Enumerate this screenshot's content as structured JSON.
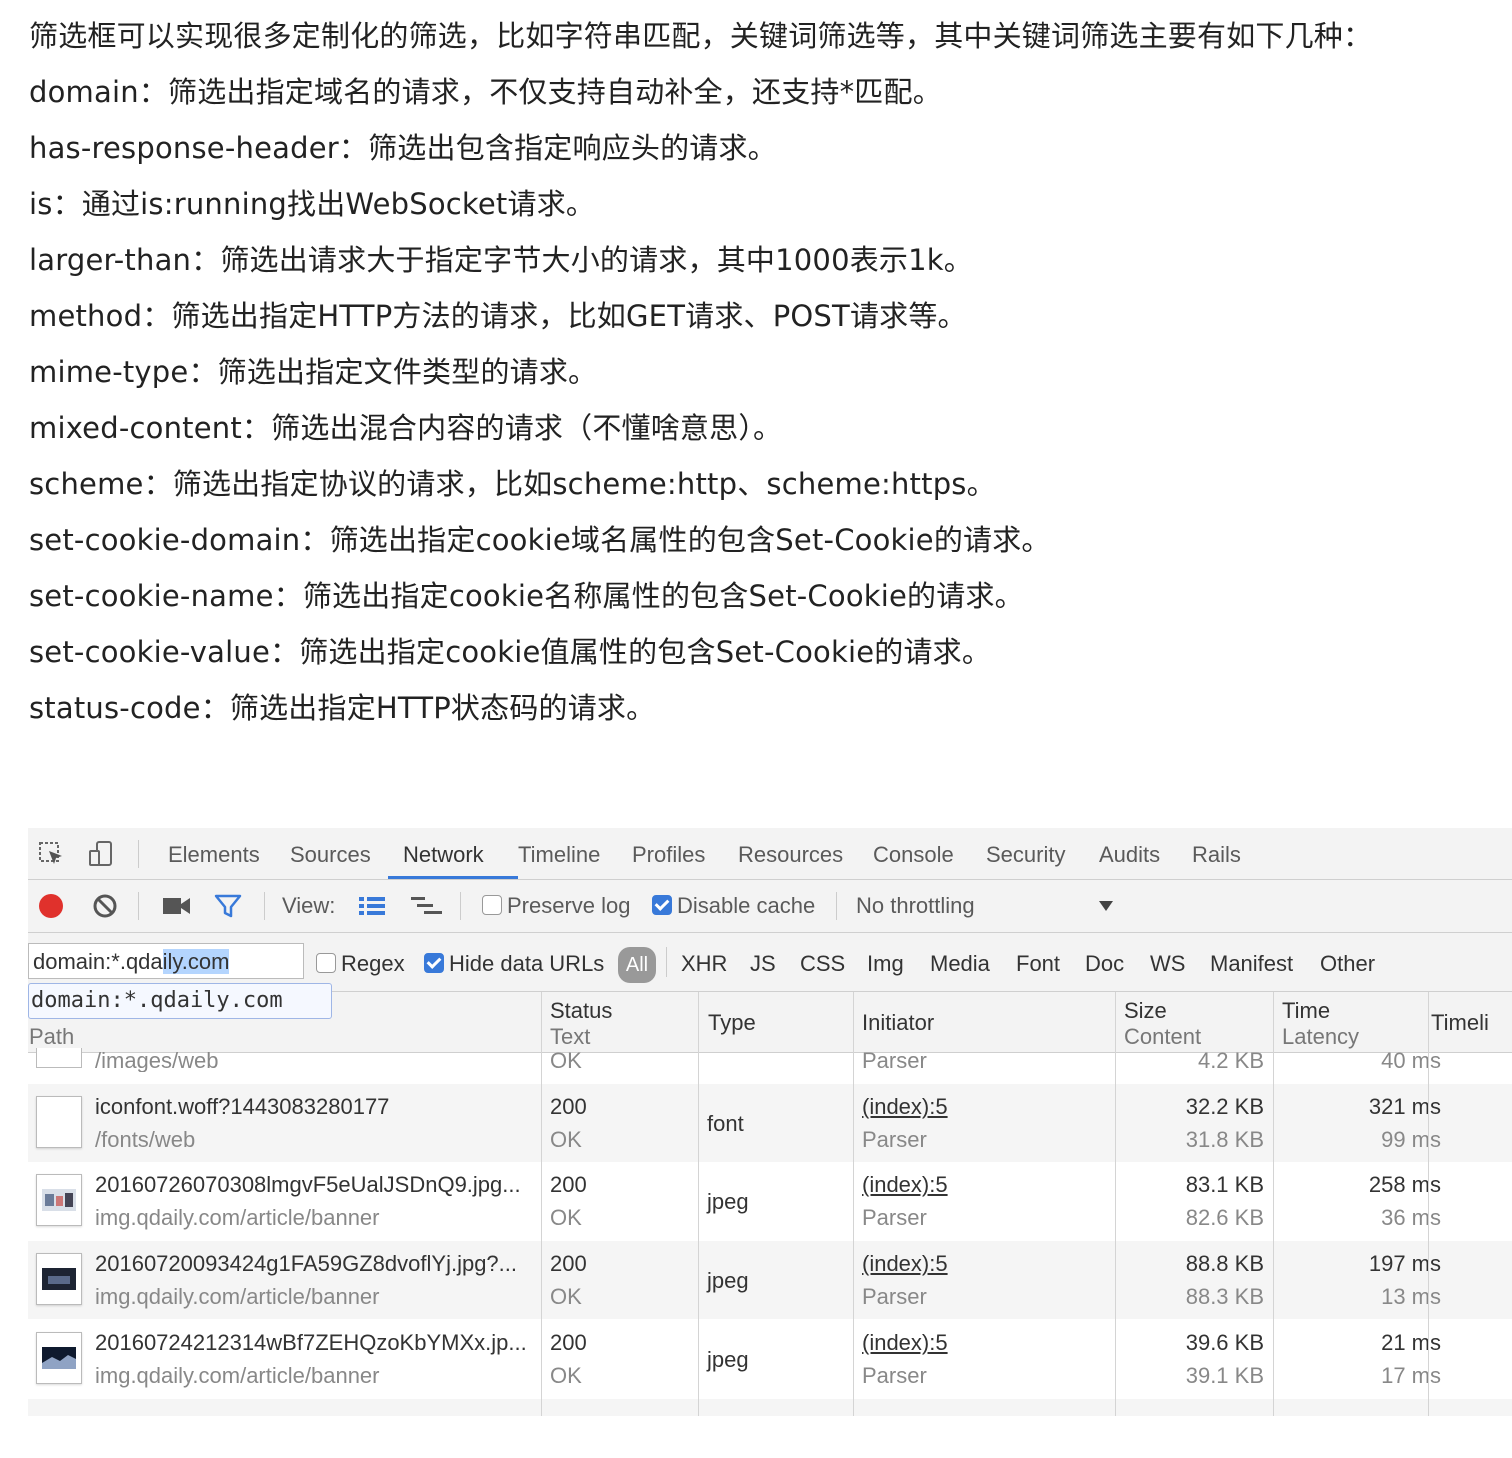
{
  "article": {
    "intro": "筛选框可以实现很多定制化的筛选，比如字符串匹配，关键词筛选等，其中关键词筛选主要有如下几种：",
    "lines": [
      "domain：筛选出指定域名的请求，不仅支持自动补全，还支持*匹配。",
      "has-response-header：筛选出包含指定响应头的请求。",
      "is：通过is:running找出WebSocket请求。",
      "larger-than：筛选出请求大于指定字节大小的请求，其中1000表示1k。",
      "method：筛选出指定HTTP方法的请求，比如GET请求、POST请求等。",
      "mime-type：筛选出指定文件类型的请求。",
      "mixed-content：筛选出混合内容的请求（不懂啥意思）。",
      "scheme：筛选出指定协议的请求，比如scheme:http、scheme:https。",
      "set-cookie-domain：筛选出指定cookie域名属性的包含Set-Cookie的请求。",
      "set-cookie-name：筛选出指定cookie名称属性的包含Set-Cookie的请求。",
      "set-cookie-value：筛选出指定cookie值属性的包含Set-Cookie的请求。",
      "status-code：筛选出指定HTTP状态码的请求。"
    ]
  },
  "devtools": {
    "tabs": [
      "Elements",
      "Sources",
      "Network",
      "Timeline",
      "Profiles",
      "Resources",
      "Console",
      "Security",
      "Audits",
      "Rails"
    ],
    "active_tab": "Network",
    "toolbar": {
      "view_label": "View:",
      "preserve_log": "Preserve log",
      "disable_cache": "Disable cache",
      "throttling": "No throttling"
    },
    "filter": {
      "value_pre": "domain:*.qda",
      "value_sel": "ily.com",
      "suggestion": "domain:*.qdaily.com",
      "regex": "Regex",
      "hide_data_urls": "Hide data URLs",
      "all": "All",
      "types": [
        "XHR",
        "JS",
        "CSS",
        "Img",
        "Media",
        "Font",
        "Doc",
        "WS",
        "Manifest",
        "Other"
      ]
    },
    "columns": {
      "path": "Path",
      "status": "Status",
      "status_sub": "Text",
      "type": "Type",
      "initiator": "Initiator",
      "size": "Size",
      "size_sub": "Content",
      "time": "Time",
      "time_sub": "Latency",
      "timeline": "Timeli"
    },
    "partial_top": {
      "path": "/images/web",
      "status": "OK",
      "initiator": "Parser",
      "size": "4.2 KB",
      "time": "40 ms"
    },
    "rows": [
      {
        "name": "iconfont.woff?1443083280177",
        "path": "/fonts/web",
        "status": "200",
        "status_text": "OK",
        "type": "font",
        "initiator": "(index):5",
        "initiator_sub": "Parser",
        "size": "32.2 KB",
        "content": "31.8 KB",
        "time": "321 ms",
        "latency": "99 ms"
      },
      {
        "name": "20160726070308lmgvF5eUalJSDnQ9.jpg...",
        "path": "img.qdaily.com/article/banner",
        "status": "200",
        "status_text": "OK",
        "type": "jpeg",
        "initiator": "(index):5",
        "initiator_sub": "Parser",
        "size": "83.1 KB",
        "content": "82.6 KB",
        "time": "258 ms",
        "latency": "36 ms"
      },
      {
        "name": "20160720093424g1FA59GZ8dvoflYj.jpg?...",
        "path": "img.qdaily.com/article/banner",
        "status": "200",
        "status_text": "OK",
        "type": "jpeg",
        "initiator": "(index):5",
        "initiator_sub": "Parser",
        "size": "88.8 KB",
        "content": "88.3 KB",
        "time": "197 ms",
        "latency": "13 ms"
      },
      {
        "name": "20160724212314wBf7ZEHQzoKbYMXx.jp...",
        "path": "img.qdaily.com/article/banner",
        "status": "200",
        "status_text": "OK",
        "type": "jpeg",
        "initiator": "(index):5",
        "initiator_sub": "Parser",
        "size": "39.6 KB",
        "content": "39.1 KB",
        "time": "21 ms",
        "latency": "17 ms"
      }
    ],
    "colors": {
      "accent": "#3879d9",
      "record": "#e0312c",
      "filter_icon": "#3879d9"
    }
  }
}
